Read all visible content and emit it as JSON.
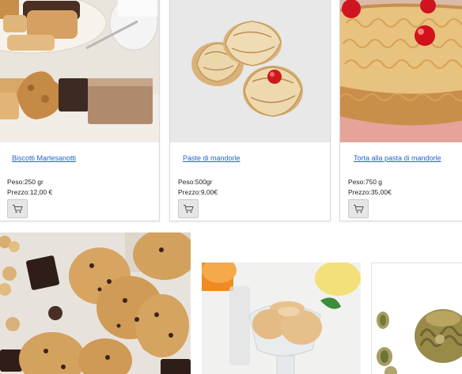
{
  "products": [
    {
      "name": "Biscotti Martesanotti",
      "weight": "Peso:250 gr",
      "price": "Prezzo:12,00 €",
      "cart_icon": "cart-icon"
    },
    {
      "name": "Paste di mandorle",
      "weight": "Peso:500gr",
      "price": "Prezzo:9,00€",
      "cart_icon": "cart-icon"
    },
    {
      "name": "Torta alla pasta di mandorle",
      "weight": "Peso:750 g",
      "price": "Prezzo:35,00€",
      "cart_icon": "cart-icon"
    }
  ],
  "colors": {
    "link": "#2563c9",
    "card_border": "#d9d9d9",
    "cart_button_bg": "#e6e6e6"
  }
}
